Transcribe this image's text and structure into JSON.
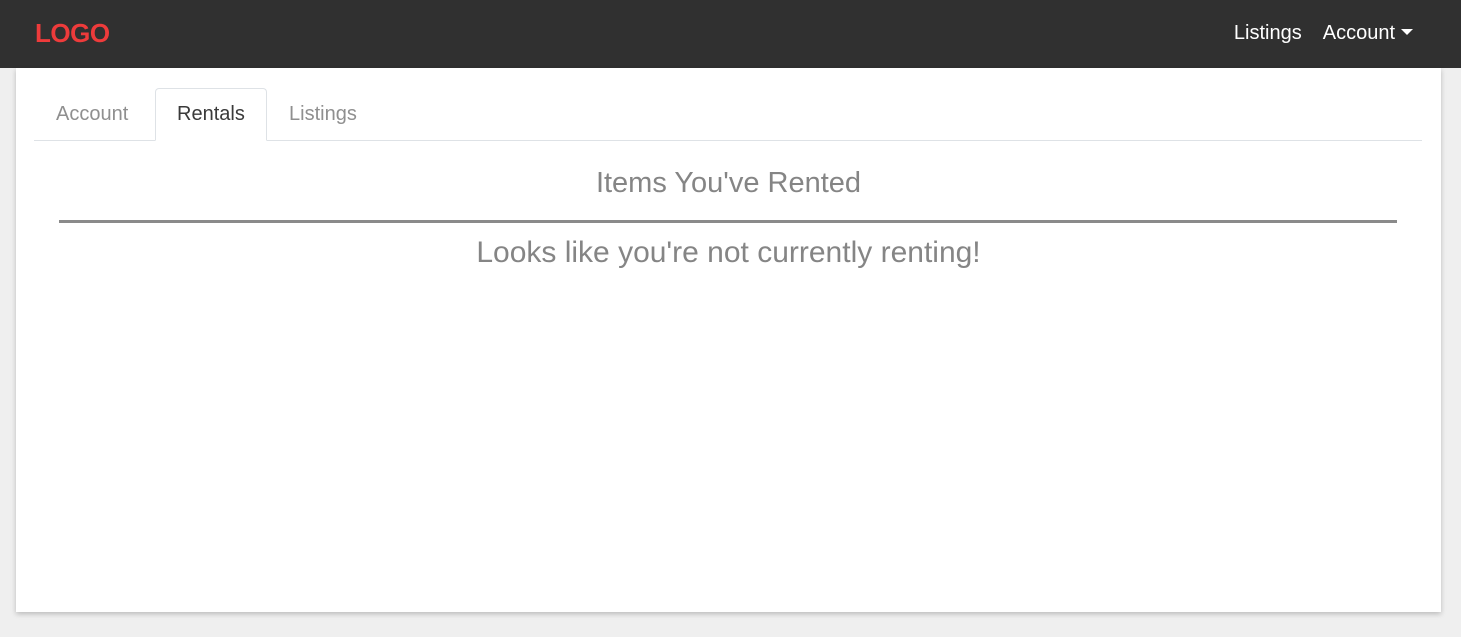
{
  "navbar": {
    "logo_text": "LOGO",
    "links": {
      "listings": "Listings",
      "account": "Account"
    }
  },
  "tabs": [
    {
      "label": "Account",
      "active": false
    },
    {
      "label": "Rentals",
      "active": true
    },
    {
      "label": "Listings",
      "active": false
    }
  ],
  "rentals": {
    "title": "Items You've Rented",
    "empty_message": "Looks like you're not currently renting!"
  },
  "colors": {
    "navbar_bg": "#303030",
    "logo": "#ee3b3b",
    "page_bg": "#efefef"
  },
  "icons": {
    "account_menu": "caret-down-icon"
  }
}
